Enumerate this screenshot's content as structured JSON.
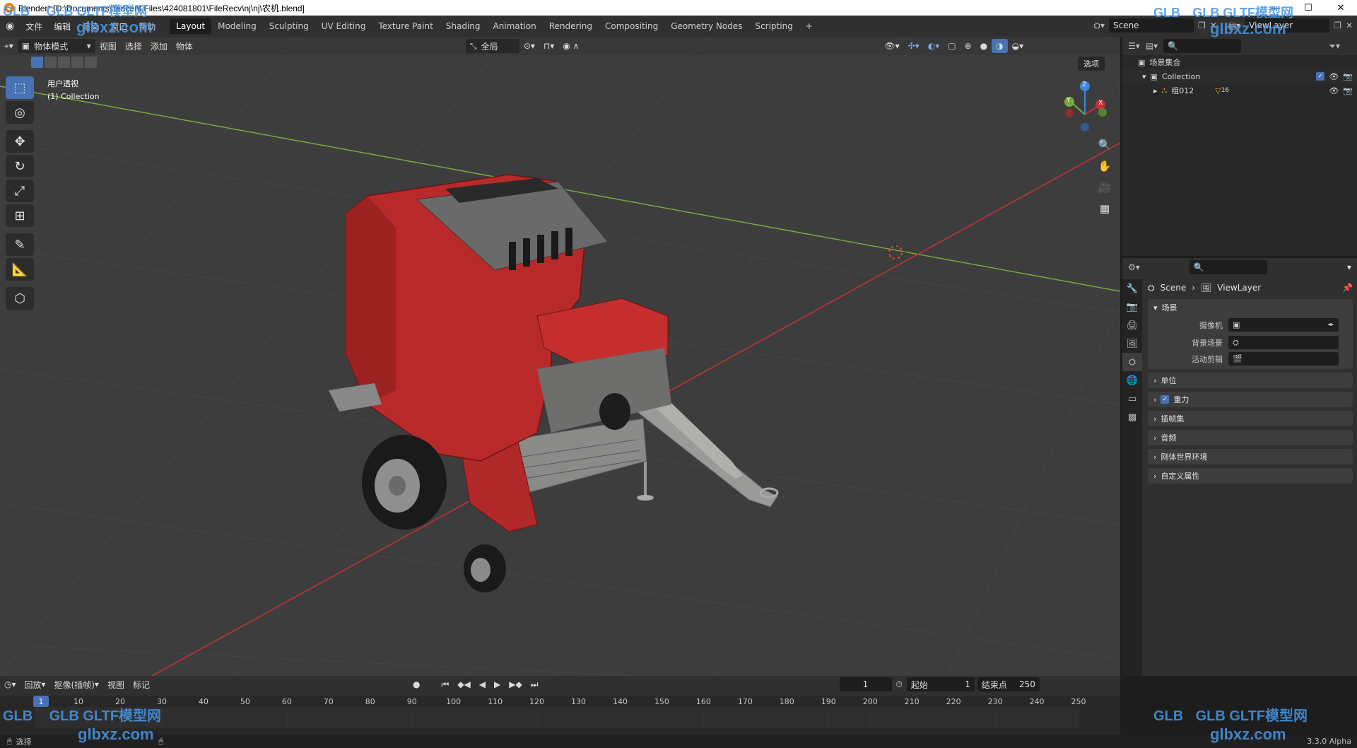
{
  "window": {
    "title": "Blender* [D:\\Documents\\Tencent Files\\424081801\\FileRecv\\nj\\nj\\农机.blend]",
    "min": "—",
    "max": "☐",
    "close": "✕"
  },
  "menu": [
    "文件",
    "编辑",
    "渲染",
    "窗口",
    "帮助"
  ],
  "workspaces": [
    "Layout",
    "Modeling",
    "Sculpting",
    "UV Editing",
    "Texture Paint",
    "Shading",
    "Animation",
    "Rendering",
    "Compositing",
    "Geometry Nodes",
    "Scripting"
  ],
  "add_workspace": "+",
  "scene_name": "Scene",
  "view_layer_name": "ViewLayer",
  "viewport": {
    "mode": "物体模式",
    "menus": [
      "视图",
      "选择",
      "添加",
      "物体"
    ],
    "orientation": "全局",
    "options": "选项",
    "view_name": "用户透视",
    "collection_info": "(1) Collection",
    "gizmo": {
      "x": "X",
      "y": "Y",
      "z": "Z"
    }
  },
  "outliner": {
    "root": "场景集合",
    "collection": "Collection",
    "object": "组012",
    "object_count": "16"
  },
  "properties": {
    "crumb_scene": "Scene",
    "crumb_layer": "ViewLayer",
    "scene_panel": "场景",
    "fields": [
      {
        "label": "摄像机",
        "value": ""
      },
      {
        "label": "背景场景",
        "value": ""
      },
      {
        "label": "活动剪辑",
        "value": ""
      }
    ],
    "collapsed_panels": [
      "单位",
      "重力",
      "插帧集",
      "音频",
      "刚体世界环境",
      "自定义属性"
    ],
    "gravity_checked": true
  },
  "timeline": {
    "menus": [
      "回放",
      "抠像(插帧)",
      "视图",
      "标记"
    ],
    "current_frame": "1",
    "start_label": "起始",
    "start": "1",
    "end_label": "结束点",
    "end": "250",
    "ticks": [
      "1",
      "10",
      "20",
      "30",
      "40",
      "50",
      "60",
      "70",
      "80",
      "90",
      "100",
      "110",
      "120",
      "130",
      "140",
      "150",
      "160",
      "170",
      "180",
      "190",
      "200",
      "210",
      "220",
      "230",
      "240",
      "250"
    ]
  },
  "statusbar": {
    "select": "选择",
    "version": "3.3.0 Alpha"
  },
  "watermark": {
    "brand": "GLB GLTF模型网",
    "url": "glbxz.com",
    "logo": "GLB"
  },
  "colors": {
    "accent": "#4772b3",
    "viewport_bg": "#3d3d3d",
    "panel_bg": "#303030",
    "x_axis": "#c8303a",
    "y_axis": "#7aa83c",
    "z_axis": "#3f86d8",
    "baler_red": "#b82a2a"
  }
}
